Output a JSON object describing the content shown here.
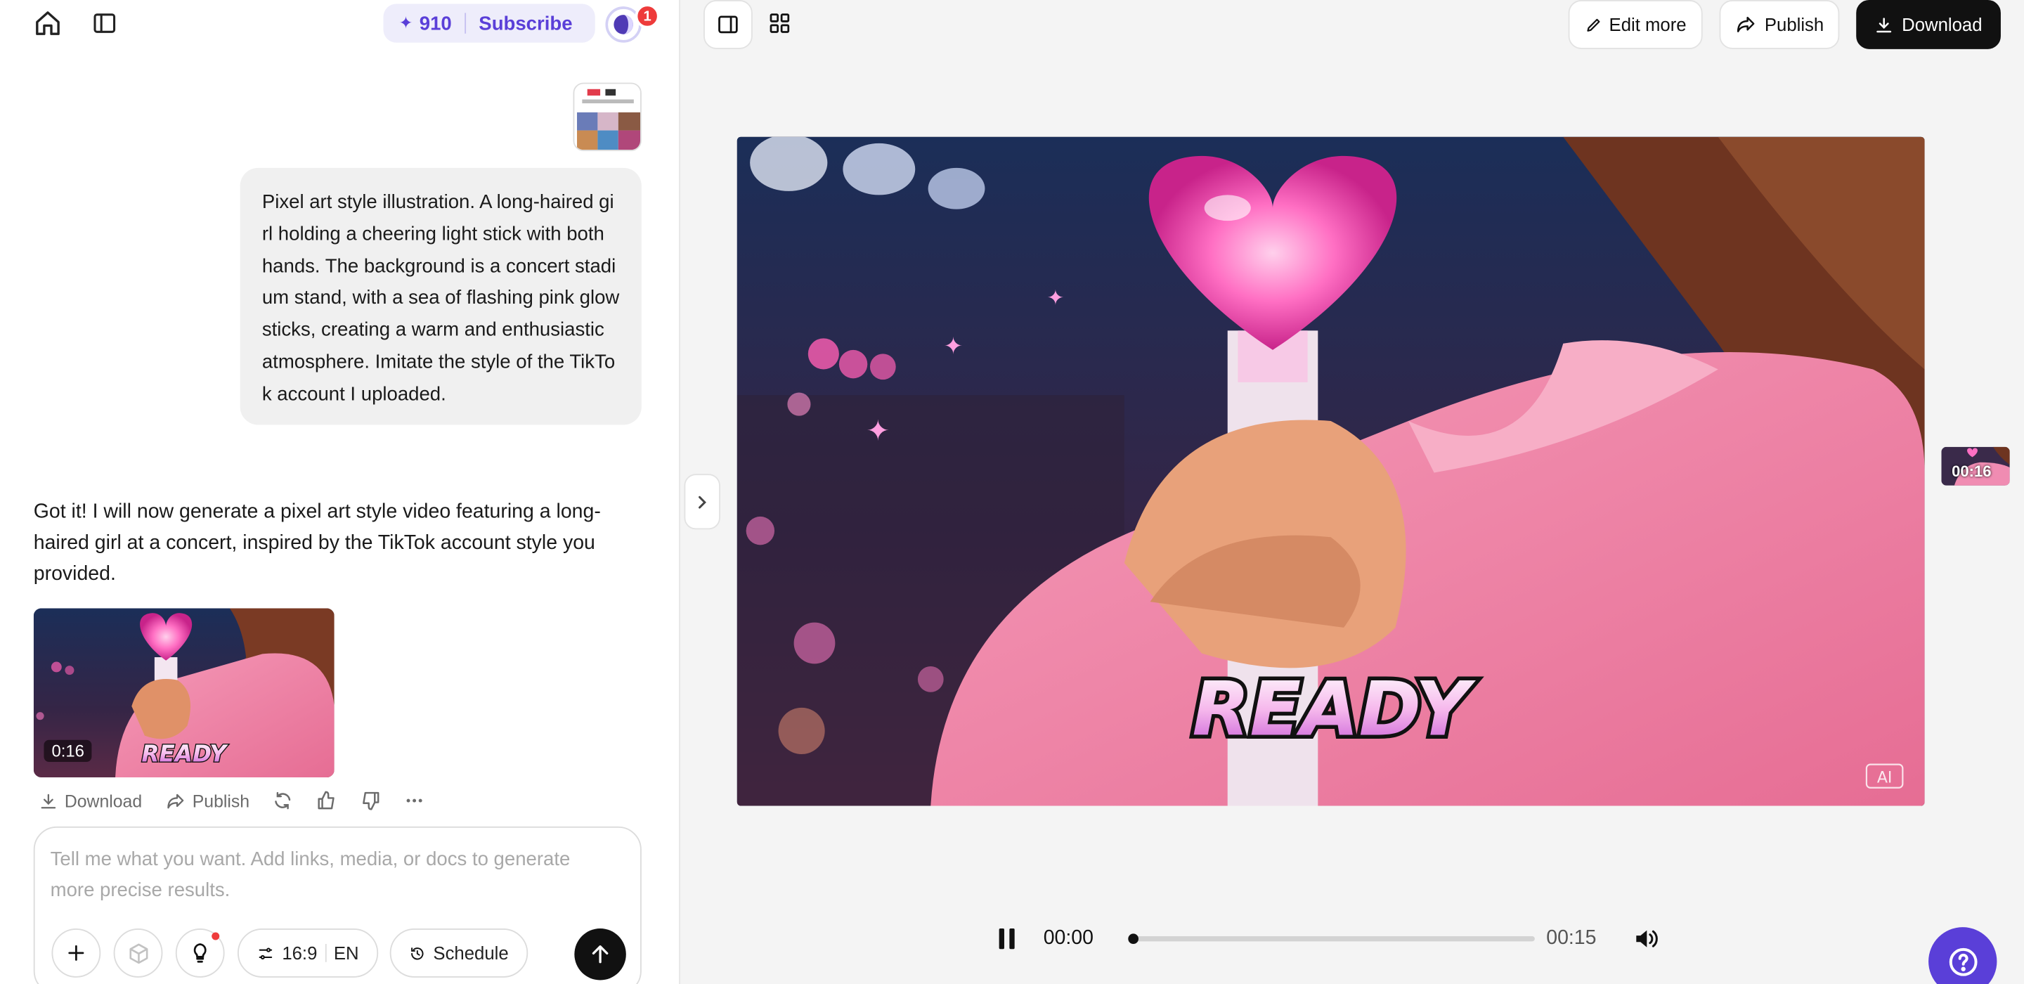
{
  "header": {
    "credits": "910",
    "subscribe_label": "Subscribe",
    "notification_count": "1"
  },
  "chat": {
    "user_prompt": "Pixel art style illustration. A long-haired girl holding a cheering light stick with both hands. The background is a concert stadium stand, with a sea of flashing pink glow sticks, creating a warm and enthusiastic atmosphere. Imitate the style of the TikTok account I uploaded.",
    "assistant_reply": "Got it! I will now generate a pixel art style video featuring a long-haired girl at a concert, inspired by the TikTok account style you provided.",
    "video_duration": "0:16",
    "video_caption": "READY",
    "actions": {
      "download": "Download",
      "publish": "Publish"
    }
  },
  "composer": {
    "placeholder": "Tell me what you want. Add links, media, or docs to generate more precise results.",
    "aspect_ratio": "16:9",
    "language": "EN",
    "schedule_label": "Schedule"
  },
  "toolbar": {
    "edit_more": "Edit more",
    "publish": "Publish",
    "download": "Download"
  },
  "preview": {
    "caption": "READY",
    "ai_badge": "AI",
    "side_thumb_time": "00:16"
  },
  "player": {
    "current_time": "00:00",
    "total_time": "00:15",
    "progress": 0,
    "playing": true
  },
  "colors": {
    "accent": "#5a3fd8",
    "badge": "#ee3b3b",
    "primary_dark": "#111111"
  }
}
